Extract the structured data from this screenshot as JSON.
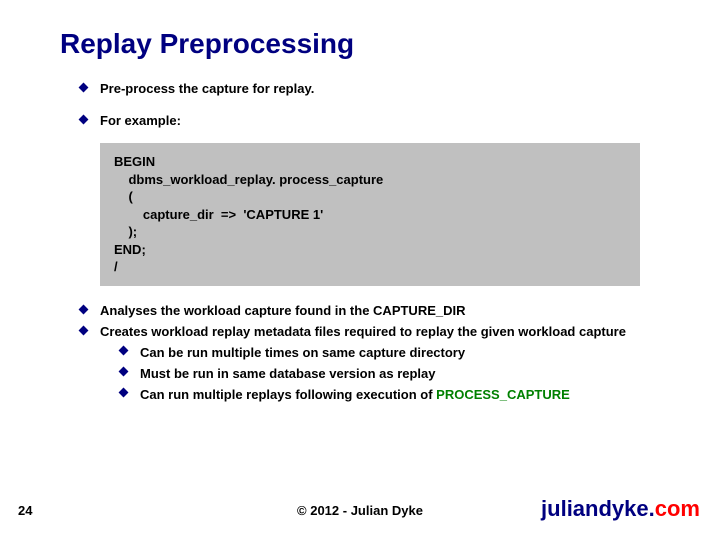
{
  "title": "Replay Preprocessing",
  "bullets_top": [
    "Pre-process the capture for replay.",
    "For example:"
  ],
  "code": "BEGIN\n    dbms_workload_replay. process_capture\n    (\n        capture_dir  =>  'CAPTURE 1'\n    );\nEND;\n/",
  "bullets_bottom": [
    {
      "text": "Analyses the workload capture found in the CAPTURE_DIR"
    },
    {
      "text": "Creates workload replay metadata files required to replay the given workload capture",
      "subs": [
        {
          "text": "Can be run multiple times on same capture directory"
        },
        {
          "text": "Must be run in same database version as replay"
        },
        {
          "text_prefix": "Can run multiple replays following execution of ",
          "text_green": "PROCESS_CAPTURE"
        }
      ]
    }
  ],
  "page_number": "24",
  "copyright": "© 2012 - Julian Dyke",
  "site_prefix": "juliandyke.",
  "site_suffix": "com"
}
